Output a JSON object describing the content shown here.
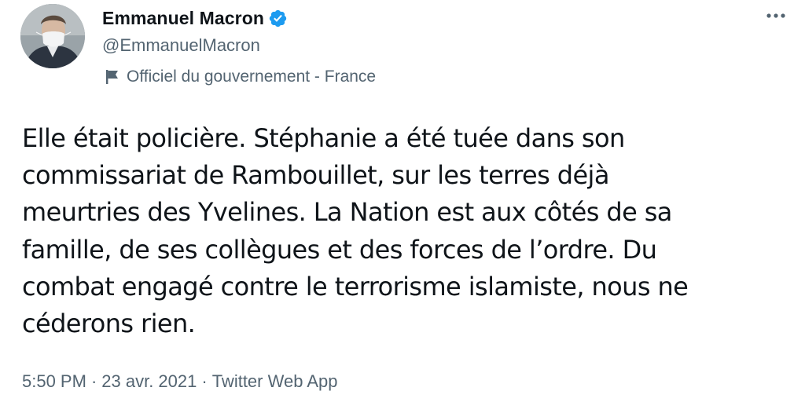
{
  "author": {
    "display_name": "Emmanuel Macron",
    "handle": "@EmmanuelMacron",
    "verified": true,
    "gov_label": "Officiel du gouvernement - France"
  },
  "tweet": {
    "lines": [
      "Elle était policière. Stéphanie a été tuée dans son",
      "commissariat de Rambouillet, sur les terres déjà",
      "meurtries des Yvelines. La Nation est aux côtés de sa",
      "famille, de ses collègues et des forces de l’ordre. Du",
      "combat engagé contre le terrorisme islamiste, nous ne",
      "céderons rien."
    ]
  },
  "meta": {
    "time": "5:50 PM",
    "separator": "·",
    "date": "23 avr. 2021",
    "source": "Twitter Web App"
  },
  "icons": {
    "verified": "verified-badge-icon",
    "flag": "flag-icon",
    "more": "more-horizontal-icon"
  },
  "colors": {
    "verified": "#1d9bf0",
    "text": "#0f1419",
    "secondary": "#536471"
  }
}
